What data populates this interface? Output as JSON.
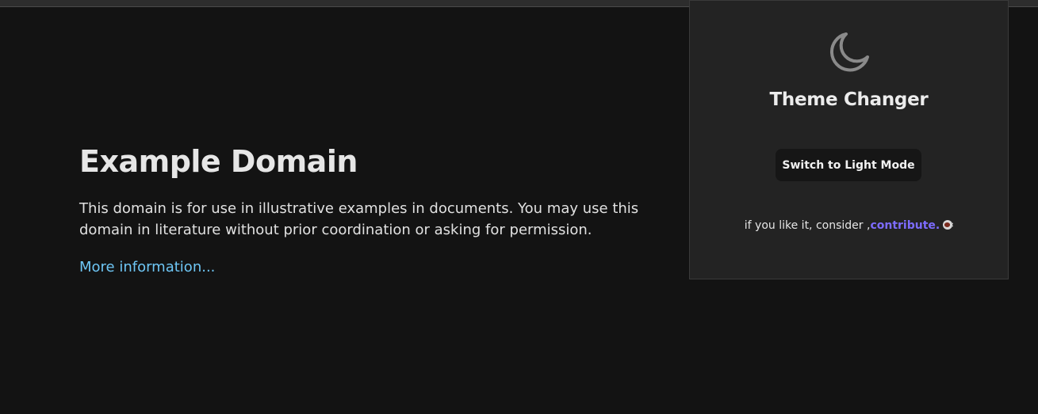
{
  "page": {
    "heading": "Example Domain",
    "description": "This domain is for use in illustrative examples in documents. You may use this domain in literature without prior coordination or asking for permission.",
    "more_link": "More information..."
  },
  "popup": {
    "icon": "moon-icon",
    "title": "Theme Changer",
    "switch_label": "Switch to Light Mode",
    "footer_prefix": "if you like it, consider ,",
    "contribute_label": "contribute.",
    "coffee_icon": "coffee-cup-icon"
  },
  "colors": {
    "background": "#131313",
    "popup_background": "#232323",
    "link": "#6ec6f5",
    "accent": "#7d6cff"
  }
}
